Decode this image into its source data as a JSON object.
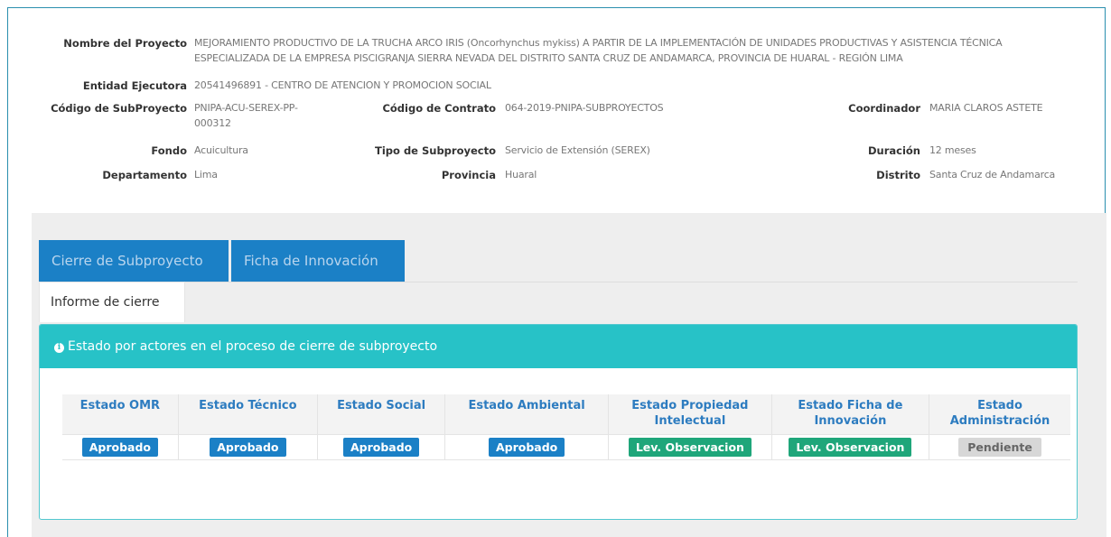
{
  "project": {
    "nombre_label": "Nombre del Proyecto",
    "nombre_line1": "MEJORAMIENTO PRODUCTIVO DE LA TRUCHA ARCO IRIS (Oncorhynchus mykiss) A PARTIR DE LA IMPLEMENTACIÓN DE UNIDADES PRODUCTIVAS Y ASISTENCIA TÉCNICA",
    "nombre_line2": "ESPECIALIZADA DE LA EMPRESA PISCIGRANJA SIERRA NEVADA DEL DISTRITO SANTA CRUZ DE ANDAMARCA, PROVINCIA DE HUARAL - REGIÓN LIMA",
    "entidad_label": "Entidad Ejecutora",
    "entidad_value": "20541496891 - CENTRO DE ATENCION Y PROMOCION SOCIAL",
    "codigo_sub_label": "Código de SubProyecto",
    "codigo_sub_line1": "PNIPA-ACU-SEREX-PP-",
    "codigo_sub_line2": "000312",
    "codigo_contrato_label": "Código de Contrato",
    "codigo_contrato_value": "064-2019-PNIPA-SUBPROYECTOS",
    "coordinador_label": "Coordinador",
    "coordinador_value": "MARIA CLAROS ASTETE",
    "fondo_label": "Fondo",
    "fondo_value": "Acuicultura",
    "tipo_label": "Tipo de Subproyecto",
    "tipo_value": "Servicio de Extensión (SEREX)",
    "duracion_label": "Duración",
    "duracion_value": "12 meses",
    "departamento_label": "Departamento",
    "departamento_value": "Lima",
    "provincia_label": "Provincia",
    "provincia_value": "Huaral",
    "distrito_label": "Distrito",
    "distrito_value": "Santa Cruz de Andamarca"
  },
  "tabs": [
    {
      "label": "Cierre de Subproyecto"
    },
    {
      "label": "Ficha de Innovación"
    }
  ],
  "subtab": {
    "label": "Informe de cierre"
  },
  "status_box": {
    "title": "Estado por actores en el proceso de cierre de subproyecto",
    "icon": "info-icon",
    "columns": [
      {
        "h1": "Estado OMR",
        "h2": "",
        "status": "Aprobado",
        "color": "#1b80c6"
      },
      {
        "h1": "Estado Técnico",
        "h2": "",
        "status": "Aprobado",
        "color": "#1b80c6"
      },
      {
        "h1": "Estado Social",
        "h2": "",
        "status": "Aprobado",
        "color": "#1b80c6"
      },
      {
        "h1": "Estado Ambiental",
        "h2": "",
        "status": "Aprobado",
        "color": "#1b80c6"
      },
      {
        "h1": "Estado Propiedad",
        "h2": "Intelectual",
        "status": "Lev. Observacion",
        "color": "#1fa67a"
      },
      {
        "h1": "Estado Ficha de",
        "h2": "Innovación",
        "status": "Lev. Observacion",
        "color": "#1fa67a"
      },
      {
        "h1": "Estado",
        "h2": "Administración",
        "status": "Pendiente",
        "color": "#d7d7d7"
      }
    ]
  }
}
